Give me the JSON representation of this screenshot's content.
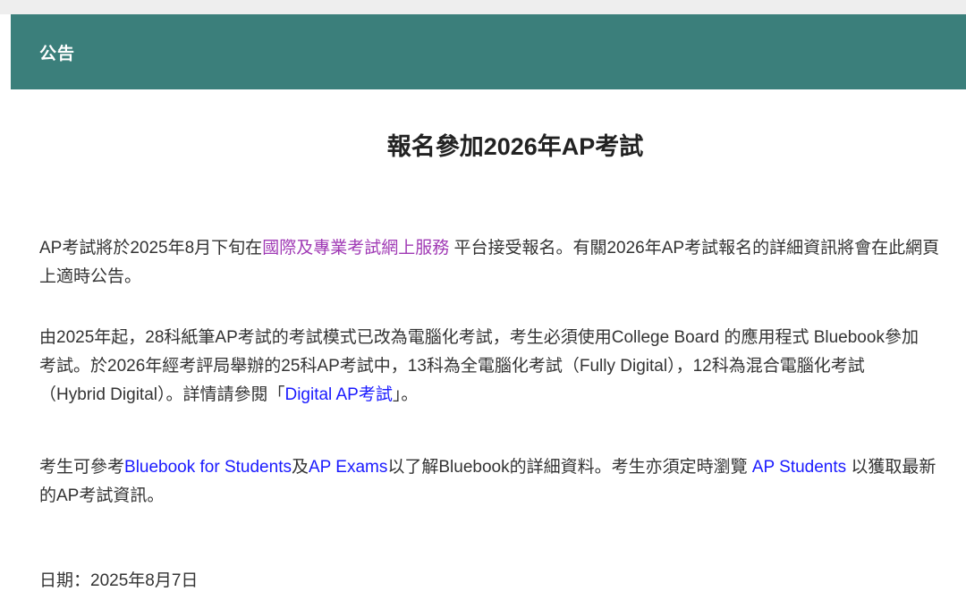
{
  "header": {
    "title": "公告"
  },
  "main": {
    "title": "報名參加2026年AP考試",
    "para1": {
      "text_before": "AP考試將於2025年8月下旬在",
      "link_text": "國際及專業考試網上服務",
      "text_after": " 平台接受報名。有關2026年AP考試報名的詳細資訊將會在此網頁上適時公告。"
    },
    "para2": {
      "text_before": "由2025年起，28科紙筆AP考試的考試模式已改為電腦化考試，考生必須使用College Board 的應用程式 Bluebook參加考試。於2026年經考評局舉辦的25科AP考試中，13科為全電腦化考試（Fully Digital），12科為混合電腦化考試（Hybrid Digital）。詳情請參閱「",
      "link_text": "Digital AP考試",
      "text_after": "」。"
    },
    "para3": {
      "text_1": "考生可參考",
      "link_1": "Bluebook for Students",
      "text_2": "及",
      "link_2": "AP Exams",
      "text_3": "以了解Bluebook的詳細資料。考生亦須定時瀏覽 ",
      "link_3": "AP Students",
      "text_4": " 以獲取最新的AP考試資訊。"
    },
    "date": "日期：2025年8月7日"
  },
  "colors": {
    "header_bg": "#3b7f7b",
    "link": "#1a1aff",
    "visited_link": "#a03ab5"
  }
}
